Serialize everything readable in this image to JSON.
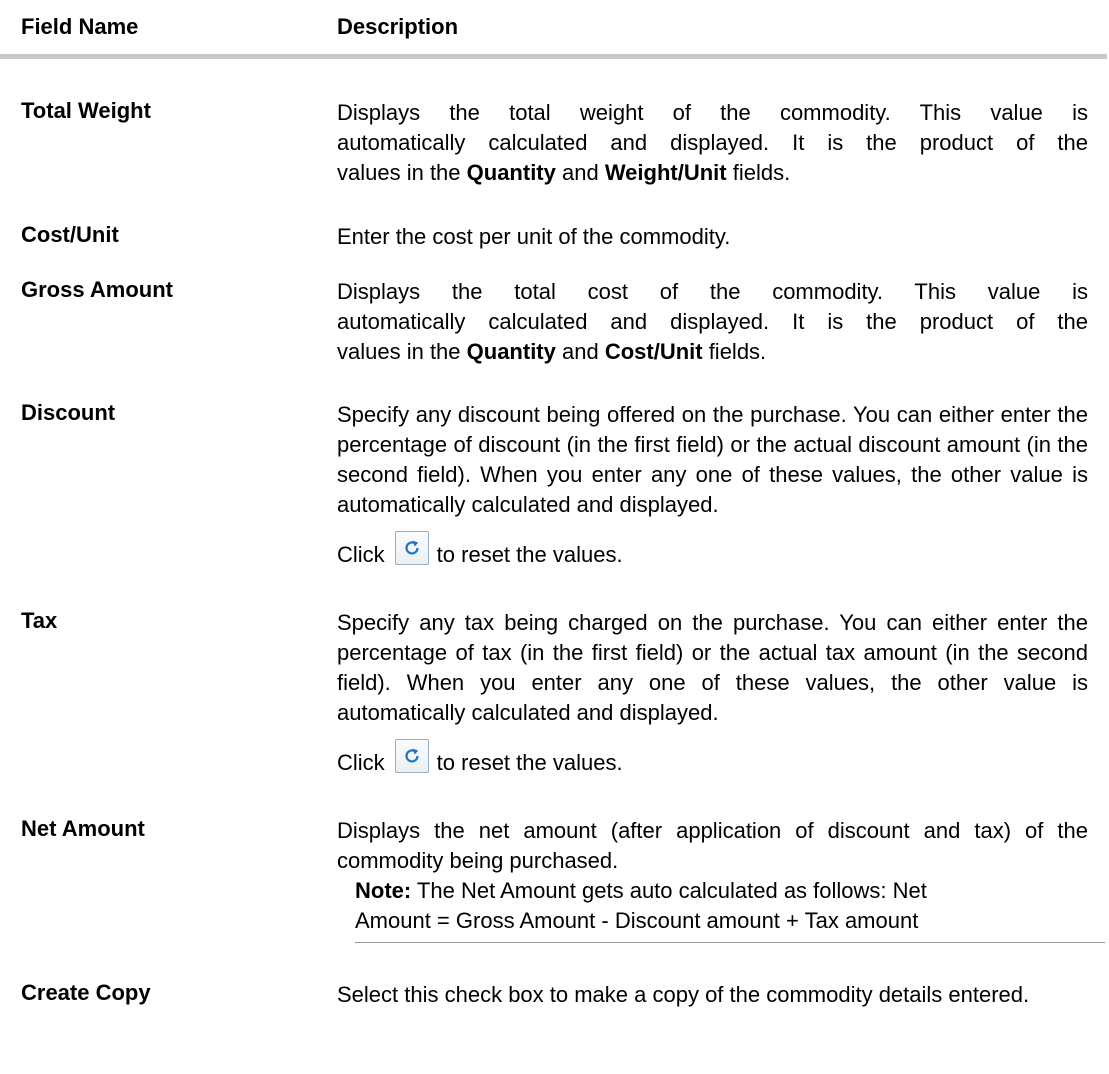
{
  "header": {
    "col1": "Field Name",
    "col2": "Description"
  },
  "rows": [
    {
      "field": "Total Weight",
      "desc_lines": [
        [
          "Displays the total weight of the commodity. This value is"
        ],
        [
          "automatically calculated and displayed. It is the product of the"
        ],
        [
          "values in the ",
          "Quantity",
          " and ",
          "Weight/Unit",
          " fields."
        ]
      ]
    },
    {
      "field": "Cost/Unit",
      "desc": "Enter the cost per unit of the commodity."
    },
    {
      "field": "Gross Amount",
      "desc_lines": [
        [
          "Displays the total cost of the commodity. This value is"
        ],
        [
          "automatically calculated and displayed. It is the product of the"
        ],
        [
          "values in the ",
          "Quantity",
          " and ",
          "Cost/Unit",
          " fields."
        ]
      ]
    },
    {
      "field": "Discount",
      "desc": "Specify any discount being offered on the purchase. You can either enter the percentage of discount (in the first field) or the actual discount amount (in the second field). When you enter any one of these values, the other value is automatically calculated and displayed.",
      "click_before": "Click",
      "click_after": "to reset the values.",
      "icon": "reset-icon"
    },
    {
      "field": "Tax",
      "desc": "Specify any tax being charged on the purchase. You can either enter the percentage of tax (in the first field) or the actual tax amount (in the second field). When you enter any one of these values, the other value is automatically calculated and displayed.",
      "click_before": "Click",
      "click_after": "to reset the values.",
      "icon": "reset-icon"
    },
    {
      "field": "Net Amount",
      "desc": "Displays the net amount (after application of discount and tax) of the commodity being purchased.",
      "note_label": "Note:",
      "note_line1": " The Net Amount gets auto calculated as follows: Net",
      "note_line2": "Amount = Gross Amount - Discount amount + Tax amount"
    },
    {
      "field": "Create Copy",
      "desc": "Select this check box to make a copy of the commodity details entered."
    }
  ],
  "colors": {
    "header_rule": "#c8c8c8",
    "icon_blue": "#1e73be"
  }
}
